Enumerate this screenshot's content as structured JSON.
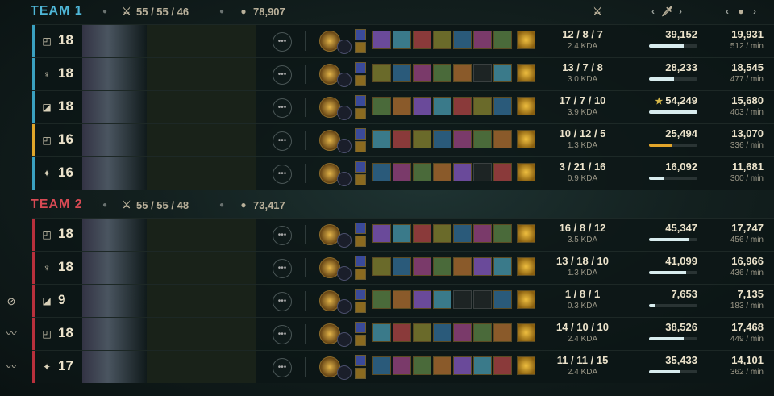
{
  "team1": {
    "name": "TEAM 1",
    "kda": "55 / 55 / 46",
    "gold": "78,907",
    "players": [
      {
        "role_icon": "top-icon",
        "level": "18",
        "kda": "12 / 8 / 7",
        "kda_ratio": "2.4 KDA",
        "damage": "39,152",
        "damage_fraction": 0.72,
        "gold": "19,931",
        "gold_per_min": "512 / min",
        "star": ""
      },
      {
        "role_icon": "jungle-icon",
        "level": "18",
        "kda": "13 / 7 / 8",
        "kda_ratio": "3.0 KDA",
        "damage": "28,233",
        "damage_fraction": 0.52,
        "gold": "18,545",
        "gold_per_min": "477 / min",
        "star": ""
      },
      {
        "role_icon": "mid-icon",
        "level": "18",
        "kda": "17 / 7 / 10",
        "kda_ratio": "3.9 KDA",
        "damage": "54,249",
        "damage_fraction": 1.0,
        "gold": "15,680",
        "gold_per_min": "403 / min",
        "star": "★"
      },
      {
        "role_icon": "top-icon",
        "level": "16",
        "kda": "10 / 12 / 5",
        "kda_ratio": "1.3 KDA",
        "damage": "25,494",
        "damage_fraction": 0.47,
        "gold": "13,070",
        "gold_per_min": "336 / min",
        "star": ""
      },
      {
        "role_icon": "support-icon",
        "level": "16",
        "kda": "3 / 21 / 16",
        "kda_ratio": "0.9 KDA",
        "damage": "16,092",
        "damage_fraction": 0.3,
        "gold": "11,681",
        "gold_per_min": "300 / min",
        "star": ""
      }
    ]
  },
  "team2": {
    "name": "TEAM 2",
    "kda": "55 / 55 / 48",
    "gold": "73,417",
    "players": [
      {
        "role_icon": "top-icon",
        "level": "18",
        "kda": "16 / 8 / 12",
        "kda_ratio": "3.5 KDA",
        "damage": "45,347",
        "damage_fraction": 0.84,
        "gold": "17,747",
        "gold_per_min": "456 / min",
        "star": ""
      },
      {
        "role_icon": "jungle-icon",
        "level": "18",
        "kda": "13 / 18 / 10",
        "kda_ratio": "1.3 KDA",
        "damage": "41,099",
        "damage_fraction": 0.76,
        "gold": "16,966",
        "gold_per_min": "436 / min",
        "star": ""
      },
      {
        "role_icon": "mid-icon",
        "level": "9",
        "kda": "1 / 8 / 1",
        "kda_ratio": "0.3 KDA",
        "damage": "7,653",
        "damage_fraction": 0.14,
        "gold": "7,135",
        "gold_per_min": "183 / min",
        "star": ""
      },
      {
        "role_icon": "top-icon",
        "level": "18",
        "kda": "14 / 10 / 10",
        "kda_ratio": "2.4 KDA",
        "damage": "38,526",
        "damage_fraction": 0.71,
        "gold": "17,468",
        "gold_per_min": "449 / min",
        "star": ""
      },
      {
        "role_icon": "support-icon",
        "level": "17",
        "kda": "11 / 11 / 15",
        "kda_ratio": "2.4 KDA",
        "damage": "35,433",
        "damage_fraction": 0.65,
        "gold": "14,101",
        "gold_per_min": "362 / min",
        "star": ""
      }
    ]
  },
  "columns": {
    "kda_icon": "crossed-swords-icon",
    "damage_icon": "sword-icon",
    "gold_icon": "gold-coins-icon",
    "chevron_left": "‹",
    "chevron_right": "›"
  },
  "colors": {
    "team1": "#4fb7d8",
    "team2": "#d84a54",
    "highlight": "#e2a52a"
  }
}
